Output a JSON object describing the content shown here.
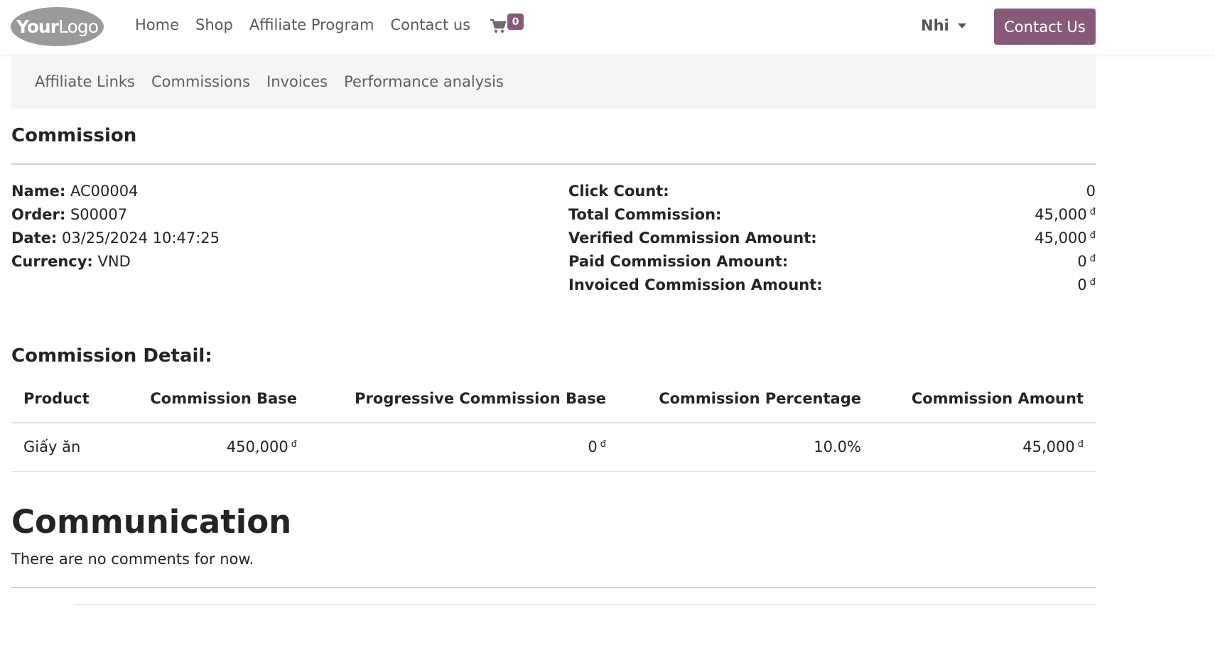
{
  "header": {
    "logo": {
      "part1": "Your",
      "part2": "Logo"
    },
    "nav": [
      "Home",
      "Shop",
      "Affiliate Program",
      "Contact us"
    ],
    "cart_count": "0",
    "user_name": "Nhi",
    "cta_label": "Contact Us"
  },
  "subnav": [
    "Affiliate Links",
    "Commissions",
    "Invoices",
    "Performance analysis"
  ],
  "commission": {
    "title": "Commission",
    "left": [
      {
        "label": "Name:",
        "value": "AC00004"
      },
      {
        "label": "Order:",
        "value": "S00007"
      },
      {
        "label": "Date:",
        "value": "03/25/2024 10:47:25"
      },
      {
        "label": "Currency:",
        "value": "VND"
      }
    ],
    "right": [
      {
        "label": "Click Count:",
        "value": "0",
        "currency": ""
      },
      {
        "label": "Total Commission:",
        "value": "45,000",
        "currency": "đ"
      },
      {
        "label": "Verified Commission Amount:",
        "value": "45,000",
        "currency": "đ"
      },
      {
        "label": "Paid Commission Amount:",
        "value": "0",
        "currency": "đ"
      },
      {
        "label": "Invoiced Commission Amount:",
        "value": "0",
        "currency": "đ"
      }
    ]
  },
  "detail": {
    "title": "Commission Detail:",
    "columns": [
      "Product",
      "Commission Base",
      "Progressive Commission Base",
      "Commission Percentage",
      "Commission Amount"
    ],
    "rows": [
      {
        "product": "Giấy ăn",
        "base": "450,000",
        "progressive": "0",
        "percentage": "10.0%",
        "amount": "45,000",
        "currency": "đ"
      }
    ]
  },
  "communication": {
    "title": "Communication",
    "empty_text": "There are no comments for now."
  },
  "colors": {
    "accent": "#875a7b",
    "subnav_bg": "#f5f5f5"
  }
}
